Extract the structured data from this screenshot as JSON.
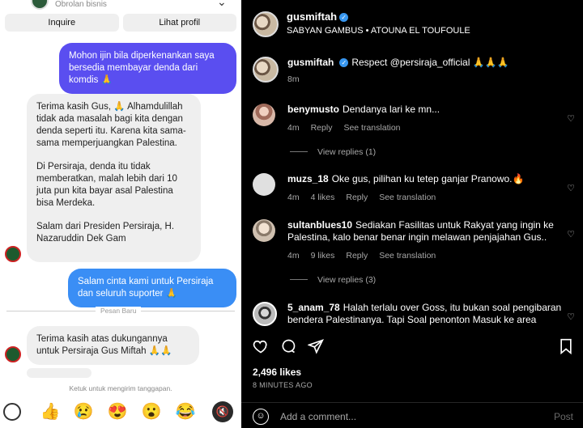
{
  "chat": {
    "header_subtitle": "Obrolan bisnis",
    "inquire_label": "Inquire",
    "profile_label": "Lihat profil",
    "msg1": "Mohon ijin bila diperkenankan saya bersedia membayar denda dari komdis 🙏",
    "msg2_p1": "Terima kasih Gus, 🙏 Alhamdulillah tidak ada masalah bagi kita dengan denda seperti itu. Karena kita sama-sama memperjuangkan Palestina.",
    "msg2_p2": "Di Persiraja, denda itu tidak memberatkan, malah lebih dari 10 juta pun kita bayar asal Palestina bisa Merdeka.",
    "msg2_p3": "Salam dari Presiden Persiraja, H. Nazaruddin Dek Gam",
    "msg3": "Salam cinta kami untuk Persiraja dan seluruh suporter 🙏",
    "divider_label": "Pesan Baru",
    "msg4": "Terima kasih atas dukungannya untuk Persiraja Gus Miftah 🙏🙏",
    "hint": "Ketuk untuk mengirim tanggapan.",
    "reactions": [
      "👍",
      "😢",
      "😍",
      "😮",
      "😂"
    ]
  },
  "post": {
    "username": "gusmiftah",
    "subtitle": "SABYAN GAMBUS • ATOUNA EL TOUFOULE",
    "caption_user": "gusmiftah",
    "caption": "Respect @persiraja_official 🙏🙏🙏",
    "caption_time": "8m",
    "likes": "2,496 likes",
    "ago": "8 MINUTES AGO",
    "add_comment_placeholder": "Add a comment...",
    "post_label": "Post"
  },
  "comments": [
    {
      "user": "benymusto",
      "text": "Dendanya lari ke mn...",
      "time": "4m",
      "likes": "",
      "reply": "Reply",
      "translate": "See translation"
    },
    {
      "user": "muzs_18",
      "text": "Oke gus, pilihan ku tetep ganjar Pranowo.🔥",
      "time": "4m",
      "likes": "4 likes",
      "reply": "Reply",
      "translate": "See translation"
    },
    {
      "user": "sultanblues10",
      "text": "Sediakan Fasilitas untuk Rakyat yang ingin ke Palestina, kalo benar benar ingin melawan penjajahan Gus..",
      "time": "4m",
      "likes": "9 likes",
      "reply": "Reply",
      "translate": "See translation"
    },
    {
      "user": "5_anam_78",
      "text": "Halah terlalu over Goss, itu bukan soal pengibaran bendera Palestinanya. Tapi Soal penonton Masuk ke area"
    }
  ],
  "view_replies": [
    "View replies (1)",
    "View replies (3)"
  ],
  "colors": {
    "outgoing_purple": "#5a4ef0",
    "outgoing_blue": "#3a8ef5",
    "incoming": "#efefef",
    "ig_bg": "#000000",
    "verified": "#3897f0"
  }
}
